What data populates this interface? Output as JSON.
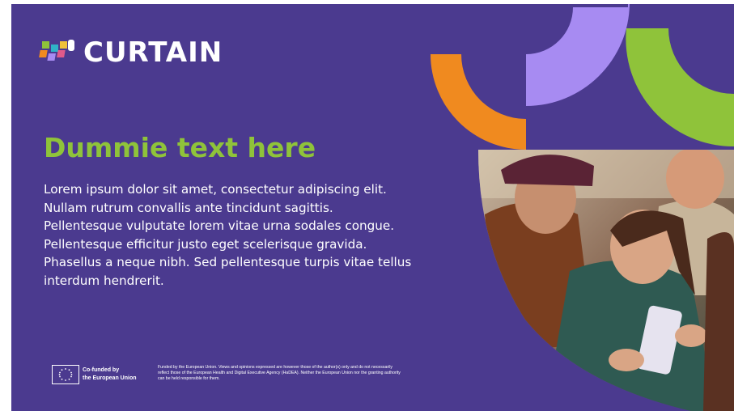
{
  "brand": {
    "name": "CURTAIN",
    "colors": {
      "background": "#4b3a8f",
      "green": "#8fc33a",
      "orange": "#f08a1f",
      "lavender": "#a78bf2",
      "white": "#ffffff"
    }
  },
  "heading": "Dummie text here",
  "body_lines": [
    "Lorem ipsum dolor sit amet, consectetur adipiscing elit.",
    "Nullam rutrum convallis ante tincidunt sagittis.",
    "Pellentesque vulputate lorem vitae urna sodales congue.",
    "Pellentesque efficitur justo eget scelerisque gravida.",
    "Phasellus a neque nibh. Sed pellentesque turpis vitae tellus",
    "interdum hendrerit."
  ],
  "footer": {
    "eu_label_line1": "Co-funded by",
    "eu_label_line2": "the European Union",
    "disclaimer": "Funded by the European Union. Views and opinions expressed are however those of the author(s) only and do not necessarily reflect those of the European Health and Digital Executive Agency (HaDEA). Neither the European Union nor the granting authority can be held responsible for them."
  },
  "icons": [
    "curtain-logo-icon",
    "eu-flag-icon"
  ]
}
